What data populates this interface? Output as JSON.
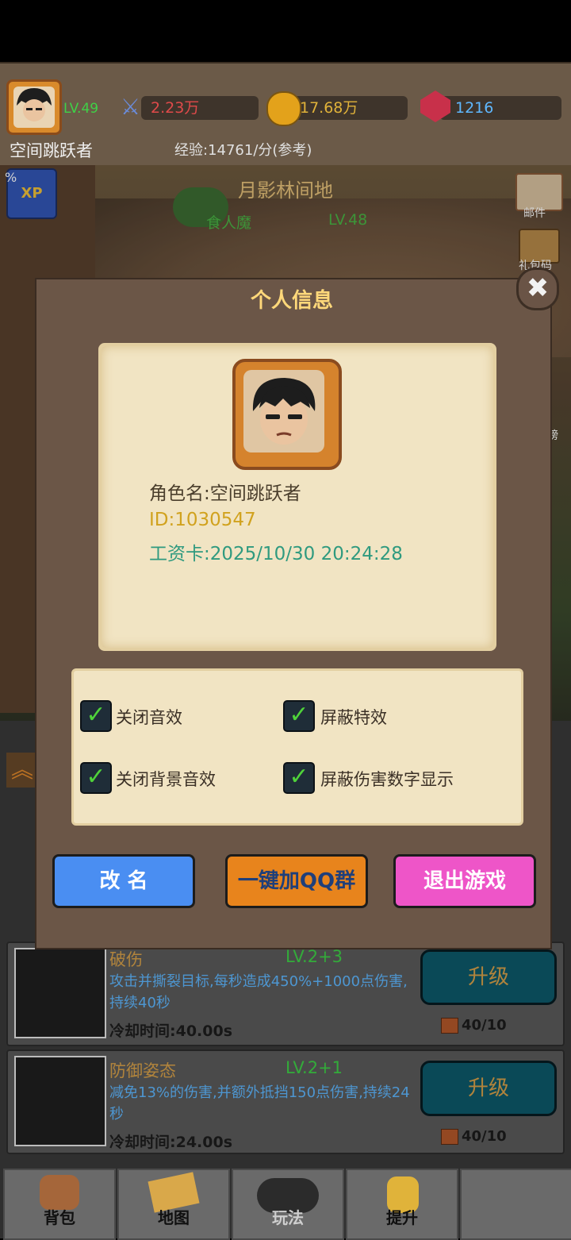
{
  "player": {
    "level": "LV.49",
    "name": "空间跳跃者",
    "power": "2.23万",
    "gold": "17.68万",
    "gems": "1216",
    "exp_rate": "经验:14761/分(参考)",
    "exp_badge_percent": "%"
  },
  "map": {
    "name": "月影林间地",
    "monster": "食人魔",
    "monster_level": "LV.48"
  },
  "side_menu": [
    {
      "icon": "mail-icon",
      "label": "邮件"
    },
    {
      "icon": "chest-icon",
      "label": "礼包码"
    },
    {
      "icon": "ranking-icon",
      "label": "榜"
    }
  ],
  "dialog": {
    "title": "个人信息",
    "close": "✖",
    "role_name": "角色名:空间跳跃者",
    "id": "ID:1030547",
    "salary_card": "工资卡:2025/10/30 20:24:28",
    "settings": [
      {
        "label": "关闭音效",
        "checked": true
      },
      {
        "label": "屏蔽特效",
        "checked": true
      },
      {
        "label": "关闭背景音效",
        "checked": true
      },
      {
        "label": "屏蔽伤害数字显示",
        "checked": true
      }
    ],
    "buttons": {
      "rename": "改 名",
      "join_qq": "一键加QQ群",
      "exit": "退出游戏"
    }
  },
  "skills": [
    {
      "name": "破伤",
      "level": "LV.2+3",
      "desc": "攻击并撕裂目标,每秒造成450%+1000点伤害,持续40秒",
      "cooldown": "冷却时间:40.00s",
      "upgrade": "升级",
      "books": "40/10"
    },
    {
      "name": "防御姿态",
      "level": "LV.2+1",
      "desc": "减免13%的伤害,并额外抵挡150点伤害,持续24秒",
      "cooldown": "冷却时间:24.00s",
      "upgrade": "升级",
      "books": "40/10"
    }
  ],
  "nav": [
    "背包",
    "地图",
    "玩法",
    "提升",
    ""
  ],
  "colors": {
    "accent": "#ffd87a",
    "rename_btn": "#4a8ef2",
    "qq_btn": "#e8841c",
    "exit_btn": "#ee55c8"
  }
}
